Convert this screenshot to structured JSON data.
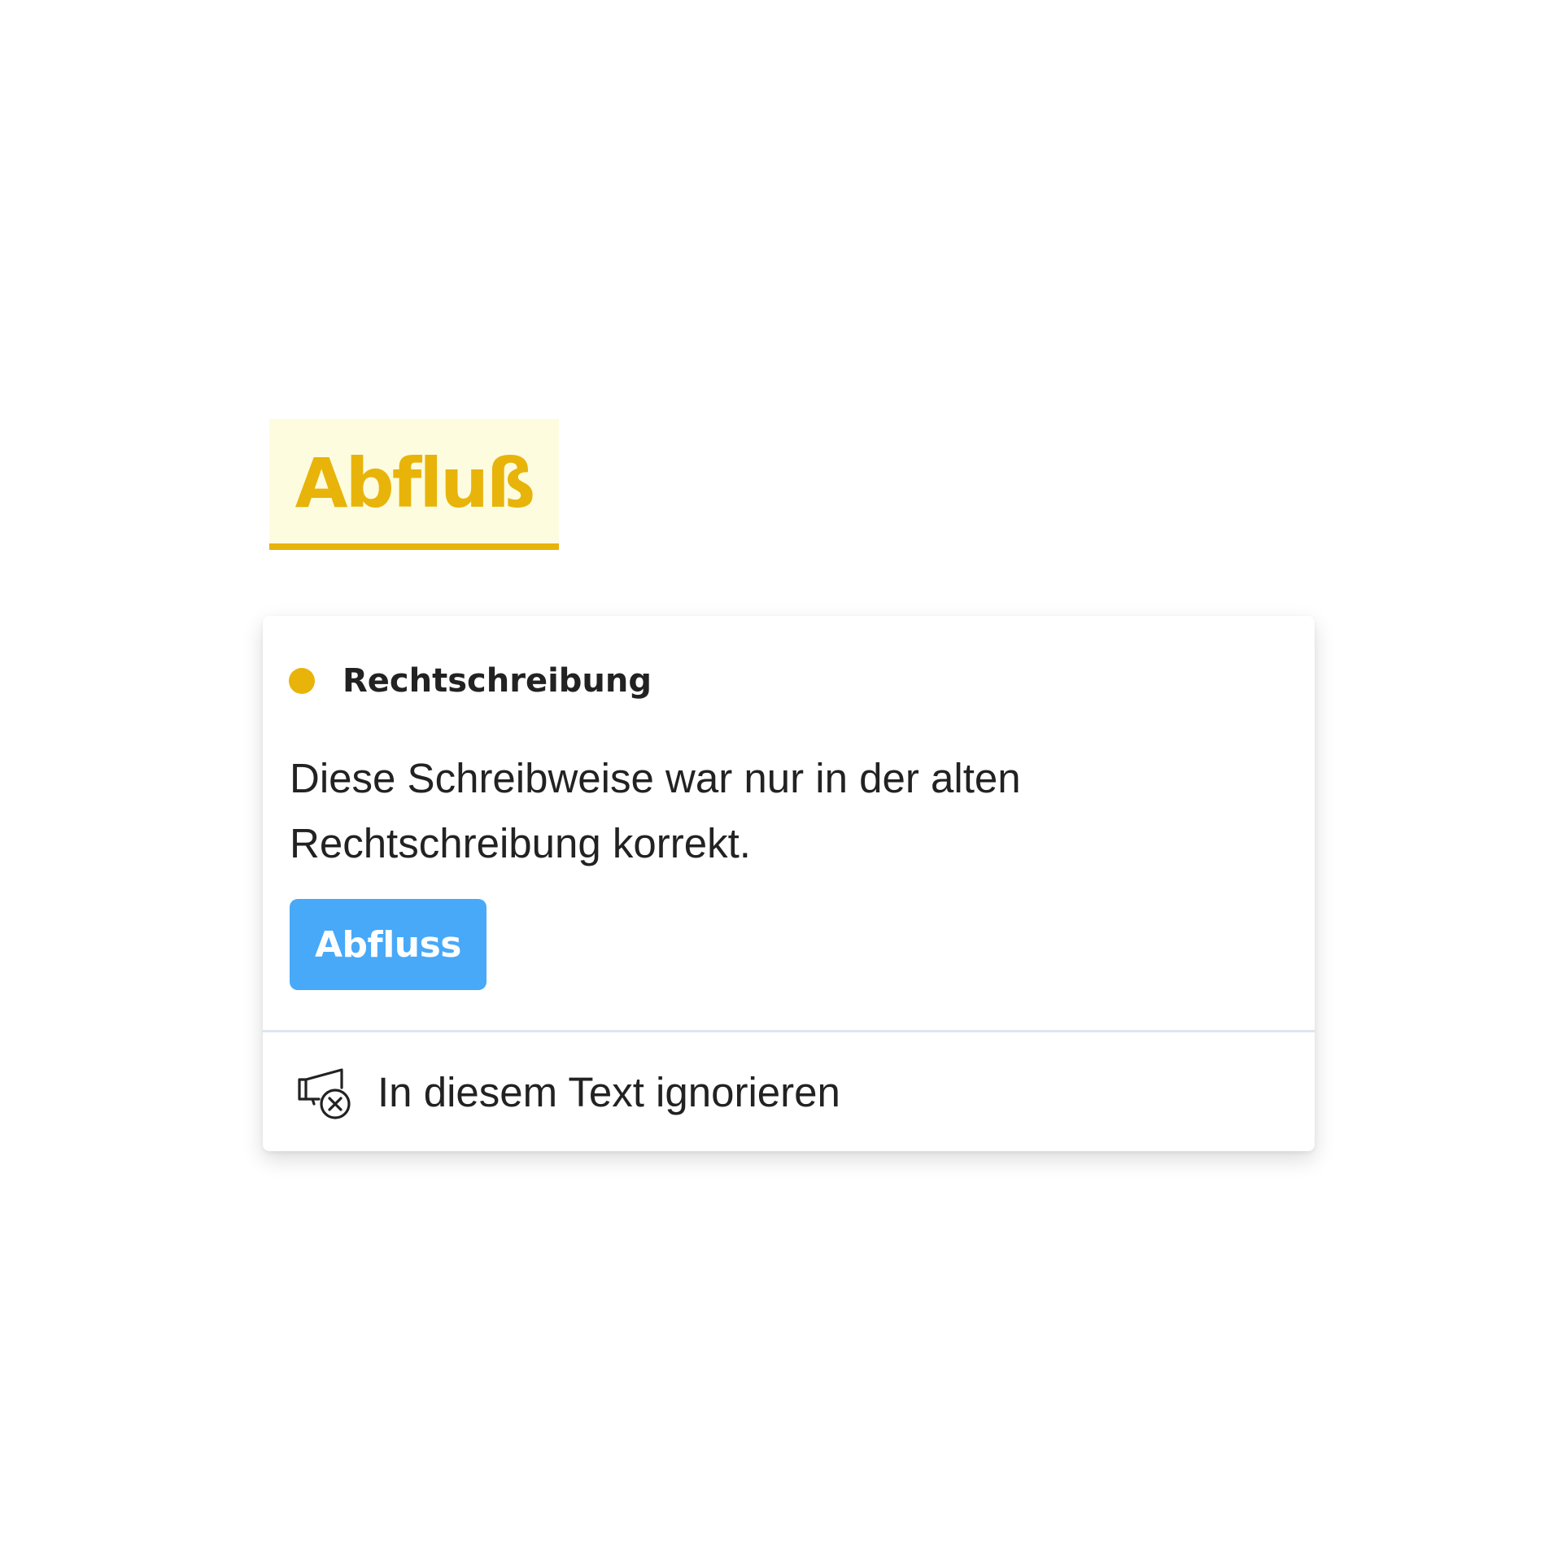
{
  "flagged_word": "Abfluß",
  "card": {
    "category": "Rechtschreibung",
    "message": "Diese Schreibweise war nur in der alten Rechtschreibung korrekt.",
    "suggestion": "Abfluss",
    "ignore_label": "In diesem Text ignorieren",
    "ignore_icon": "megaphone-x-icon"
  },
  "colors": {
    "highlight_text": "#e8b40a",
    "highlight_background": "#fdfcdf",
    "category_dot": "#e8b40a",
    "suggestion_button": "#48a9f8",
    "divider": "#dfe5ee"
  }
}
